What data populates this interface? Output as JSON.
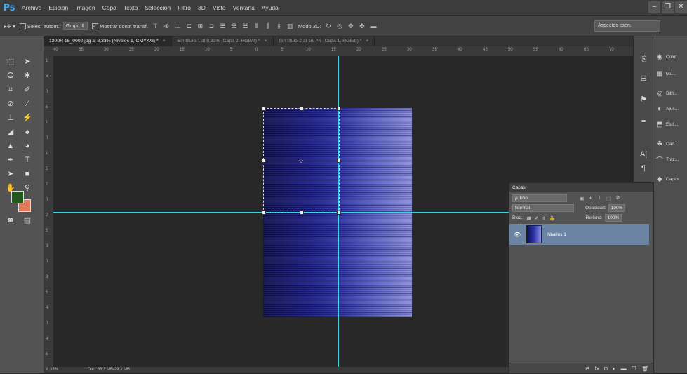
{
  "app": {
    "logo": "Ps"
  },
  "menu": [
    "Archivo",
    "Edición",
    "Imagen",
    "Capa",
    "Texto",
    "Selección",
    "Filtro",
    "3D",
    "Vista",
    "Ventana",
    "Ayuda"
  ],
  "window_controls": [
    "–",
    "❐",
    "✕"
  ],
  "options_bar": {
    "auto_select_label": "Selec. autom.:",
    "auto_select_value": "Grupo",
    "show_transform_label": "Mostrar contr. transf.",
    "mode_3d_label": "Modo 3D:",
    "workspace": "Aspectos esen."
  },
  "tabs": [
    {
      "label": "1200R 15_0002.jpg al 8,33% (Niveles 1, CMYK/8) *",
      "active": true
    },
    {
      "label": "Sin título-1 al 8,33% (Capa 2, RGB/8) *",
      "active": false
    },
    {
      "label": "Sin título-2 al 16,7% (Capa 1, RGB/8) *",
      "active": false
    }
  ],
  "ruler_h": [
    "40",
    "35",
    "30",
    "25",
    "20",
    "15",
    "10",
    "5",
    "0",
    "5",
    "10",
    "15",
    "20",
    "25",
    "30",
    "35",
    "40",
    "45",
    "50",
    "55",
    "60",
    "65",
    "70"
  ],
  "ruler_v": [
    "1",
    "5",
    "0",
    "5",
    "1",
    "0",
    "1",
    "5",
    "2",
    "0",
    "2",
    "5",
    "3",
    "0",
    "3",
    "5",
    "4",
    "0",
    "4",
    "5"
  ],
  "status": {
    "zoom": "8,33%",
    "doc": "Doc: 66,3 MB/29,3 MB"
  },
  "right_dock": [
    {
      "icon": "color-icon",
      "label": "Color"
    },
    {
      "icon": "swatches-icon",
      "label": "Mu..."
    },
    {
      "icon": "libraries-icon",
      "label": "Bibl..."
    },
    {
      "icon": "adjustments-icon",
      "label": "Ajus..."
    },
    {
      "icon": "styles-icon",
      "label": "Estil..."
    },
    {
      "icon": "channels-icon",
      "label": "Can..."
    },
    {
      "icon": "paths-icon",
      "label": "Traz..."
    },
    {
      "icon": "layers-icon",
      "label": "Capas"
    }
  ],
  "layers_panel": {
    "title": "Capas",
    "filter": "ρ Tipo",
    "blend_mode": "Normal",
    "opacity_label": "Opacidad:",
    "opacity_value": "100%",
    "lock_label": "Bloq.:",
    "fill_label": "Relleno:",
    "fill_value": "100%",
    "layers": [
      {
        "name": "Niveles 1",
        "visible": true
      }
    ]
  },
  "colors": {
    "guide": "#3ad4e6",
    "foreground": "#1f5a1a",
    "background": "#e07a5c",
    "layer_selected": "#6b84a3"
  }
}
